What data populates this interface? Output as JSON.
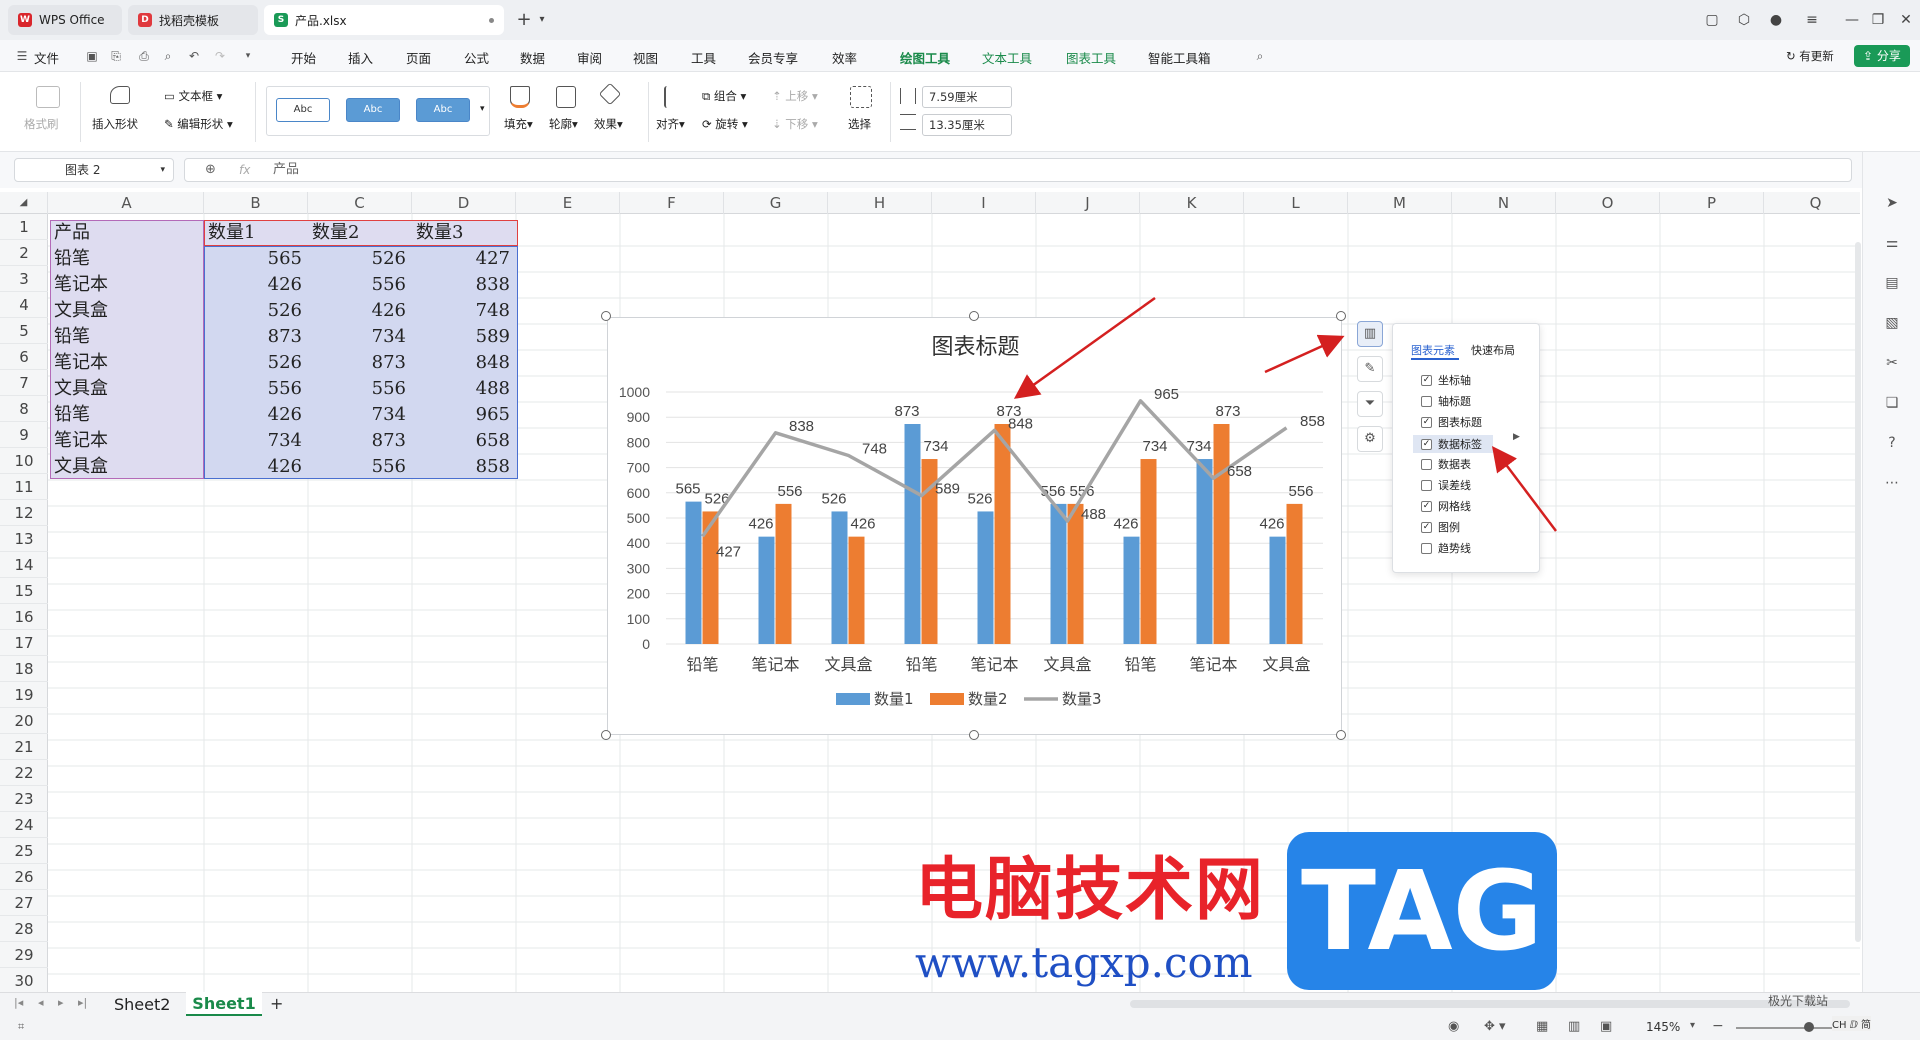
{
  "tabs": [
    {
      "label": "WPS Office",
      "icon": "wps-logo-icon"
    },
    {
      "label": "找稻壳模板",
      "icon": "docer-logo-icon"
    },
    {
      "label": "产品.xlsx",
      "icon": "spreadsheet-file-icon"
    }
  ],
  "menubar": {
    "file": "文件",
    "items": [
      "开始",
      "插入",
      "页面",
      "公式",
      "数据",
      "审阅",
      "视图",
      "工具",
      "会员专享",
      "效率",
      "绘图工具",
      "文本工具",
      "图表工具",
      "智能工具箱"
    ],
    "selected": "绘图工具",
    "update": "有更新",
    "share": "分享"
  },
  "ribbon": {
    "format_painter": "格式刷",
    "insert_shape": "插入形状",
    "text_box": "文本框",
    "edit_shape": "编辑形状",
    "style_samples": [
      "Abc",
      "Abc",
      "Abc"
    ],
    "fill": "填充",
    "outline": "轮廓",
    "effect": "效果",
    "align": "对齐",
    "group": "组合",
    "rotate": "旋转",
    "bring_forward": "上移",
    "send_backward": "下移",
    "select": "选择",
    "height": "7.59厘米",
    "width": "13.35厘米"
  },
  "formula_bar": {
    "name_box": "图表 2",
    "fx": "fx",
    "content": "产品"
  },
  "columns": [
    "A",
    "B",
    "C",
    "D",
    "E",
    "F",
    "G",
    "H",
    "I",
    "J",
    "K",
    "L",
    "M",
    "N",
    "O",
    "P",
    "Q"
  ],
  "rows": [
    "1",
    "2",
    "3",
    "4",
    "5",
    "6",
    "7",
    "8",
    "9",
    "10",
    "11",
    "12",
    "13",
    "14",
    "15",
    "16",
    "17",
    "18",
    "19",
    "20",
    "21",
    "22",
    "23",
    "24",
    "25",
    "26",
    "27",
    "28",
    "29",
    "30"
  ],
  "table": {
    "headers": [
      "产品",
      "数量1",
      "数量2",
      "数量3"
    ],
    "rows": [
      [
        "铅笔",
        "565",
        "526",
        "427"
      ],
      [
        "笔记本",
        "426",
        "556",
        "838"
      ],
      [
        "文具盒",
        "526",
        "426",
        "748"
      ],
      [
        "铅笔",
        "873",
        "734",
        "589"
      ],
      [
        "笔记本",
        "526",
        "873",
        "848"
      ],
      [
        "文具盒",
        "556",
        "556",
        "488"
      ],
      [
        "铅笔",
        "426",
        "734",
        "965"
      ],
      [
        "笔记本",
        "734",
        "873",
        "658"
      ],
      [
        "文具盒",
        "426",
        "556",
        "858"
      ]
    ]
  },
  "chart_data": {
    "type": "bar",
    "title": "图表标题",
    "categories": [
      "铅笔",
      "笔记本",
      "文具盒",
      "铅笔",
      "笔记本",
      "文具盒",
      "铅笔",
      "笔记本",
      "文具盒"
    ],
    "series": [
      {
        "name": "数量1",
        "type": "bar",
        "color": "#5b9bd5",
        "values": [
          565,
          426,
          526,
          873,
          526,
          556,
          426,
          734,
          426
        ]
      },
      {
        "name": "数量2",
        "type": "bar",
        "color": "#ed7d31",
        "values": [
          526,
          556,
          426,
          734,
          873,
          556,
          734,
          873,
          556
        ]
      },
      {
        "name": "数量3",
        "type": "line",
        "color": "#a5a5a5",
        "values": [
          427,
          838,
          748,
          589,
          848,
          488,
          965,
          658,
          858
        ]
      }
    ],
    "ylim": [
      0,
      1000
    ],
    "yticks": [
      0,
      100,
      200,
      300,
      400,
      500,
      600,
      700,
      800,
      900,
      1000
    ],
    "data_labels": true,
    "grid": true,
    "legend": "bottom"
  },
  "chart_elements_panel": {
    "tab_elements": "图表元素",
    "tab_layout": "快速布局",
    "items": [
      {
        "label": "坐标轴",
        "checked": true
      },
      {
        "label": "轴标题",
        "checked": false
      },
      {
        "label": "图表标题",
        "checked": true
      },
      {
        "label": "数据标签",
        "checked": true
      },
      {
        "label": "数据表",
        "checked": false
      },
      {
        "label": "误差线",
        "checked": false
      },
      {
        "label": "网格线",
        "checked": true
      },
      {
        "label": "图例",
        "checked": true
      },
      {
        "label": "趋势线",
        "checked": false
      }
    ]
  },
  "sheets": {
    "tabs": [
      "Sheet2",
      "Sheet1"
    ],
    "active": "Sheet1",
    "add": "+"
  },
  "status": {
    "zoom": "145%",
    "ime": "CH ⅅ 简"
  },
  "watermark": {
    "text": "电脑技术网",
    "url": "www.tagxp.com",
    "tag": "TAG",
    "site": "极光下载站"
  },
  "colors": {
    "accent": "#1a8a4a",
    "selection": "#d9d9f0",
    "handle_stroke": "#666666",
    "arrow": "#d42020"
  }
}
